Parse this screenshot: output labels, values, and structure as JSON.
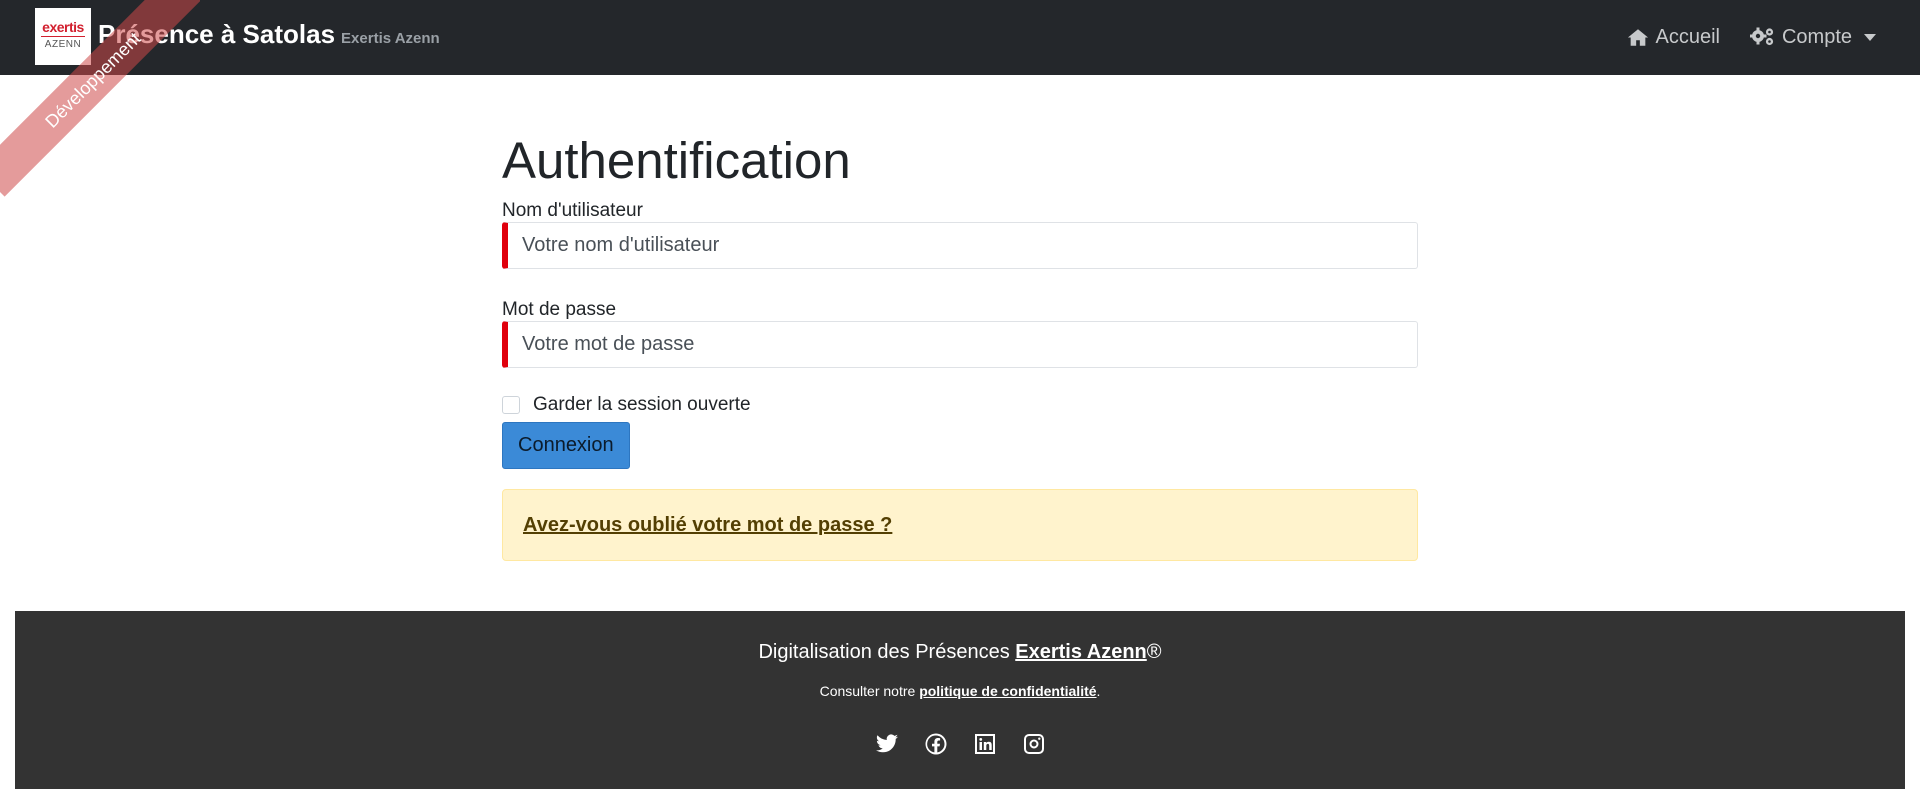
{
  "brand": {
    "logo_top": "exertis",
    "logo_bottom": "AZENN",
    "title": "Présence à Satolas",
    "subtitle": "Exertis Azenn",
    "ribbon": "Développement"
  },
  "nav": {
    "home_label": "Accueil",
    "account_label": "Compte"
  },
  "form": {
    "title": "Authentification",
    "username_label": "Nom d'utilisateur",
    "username_placeholder": "Votre nom d'utilisateur",
    "password_label": "Mot de passe",
    "password_placeholder": "Votre mot de passe",
    "remember_label": "Garder la session ouverte",
    "remember_checked": false,
    "submit_label": "Connexion",
    "forgot_link": "Avez-vous oublié votre mot de passe ?"
  },
  "footer": {
    "line1_prefix": "Digitalisation des Présences ",
    "line1_link": "Exertis Azenn",
    "line1_suffix": "®",
    "line2_prefix": "Consulter notre ",
    "line2_link": "politique de confidentialité",
    "line2_suffix": ".",
    "social": [
      "twitter-icon",
      "facebook-icon",
      "linkedin-icon",
      "instagram-icon"
    ]
  },
  "colors": {
    "navbar": "#24272b",
    "primary_button": "#3b8ad7",
    "required_border": "#e0000d",
    "alert_bg": "#fff3cd",
    "footer_bg": "#333333"
  }
}
